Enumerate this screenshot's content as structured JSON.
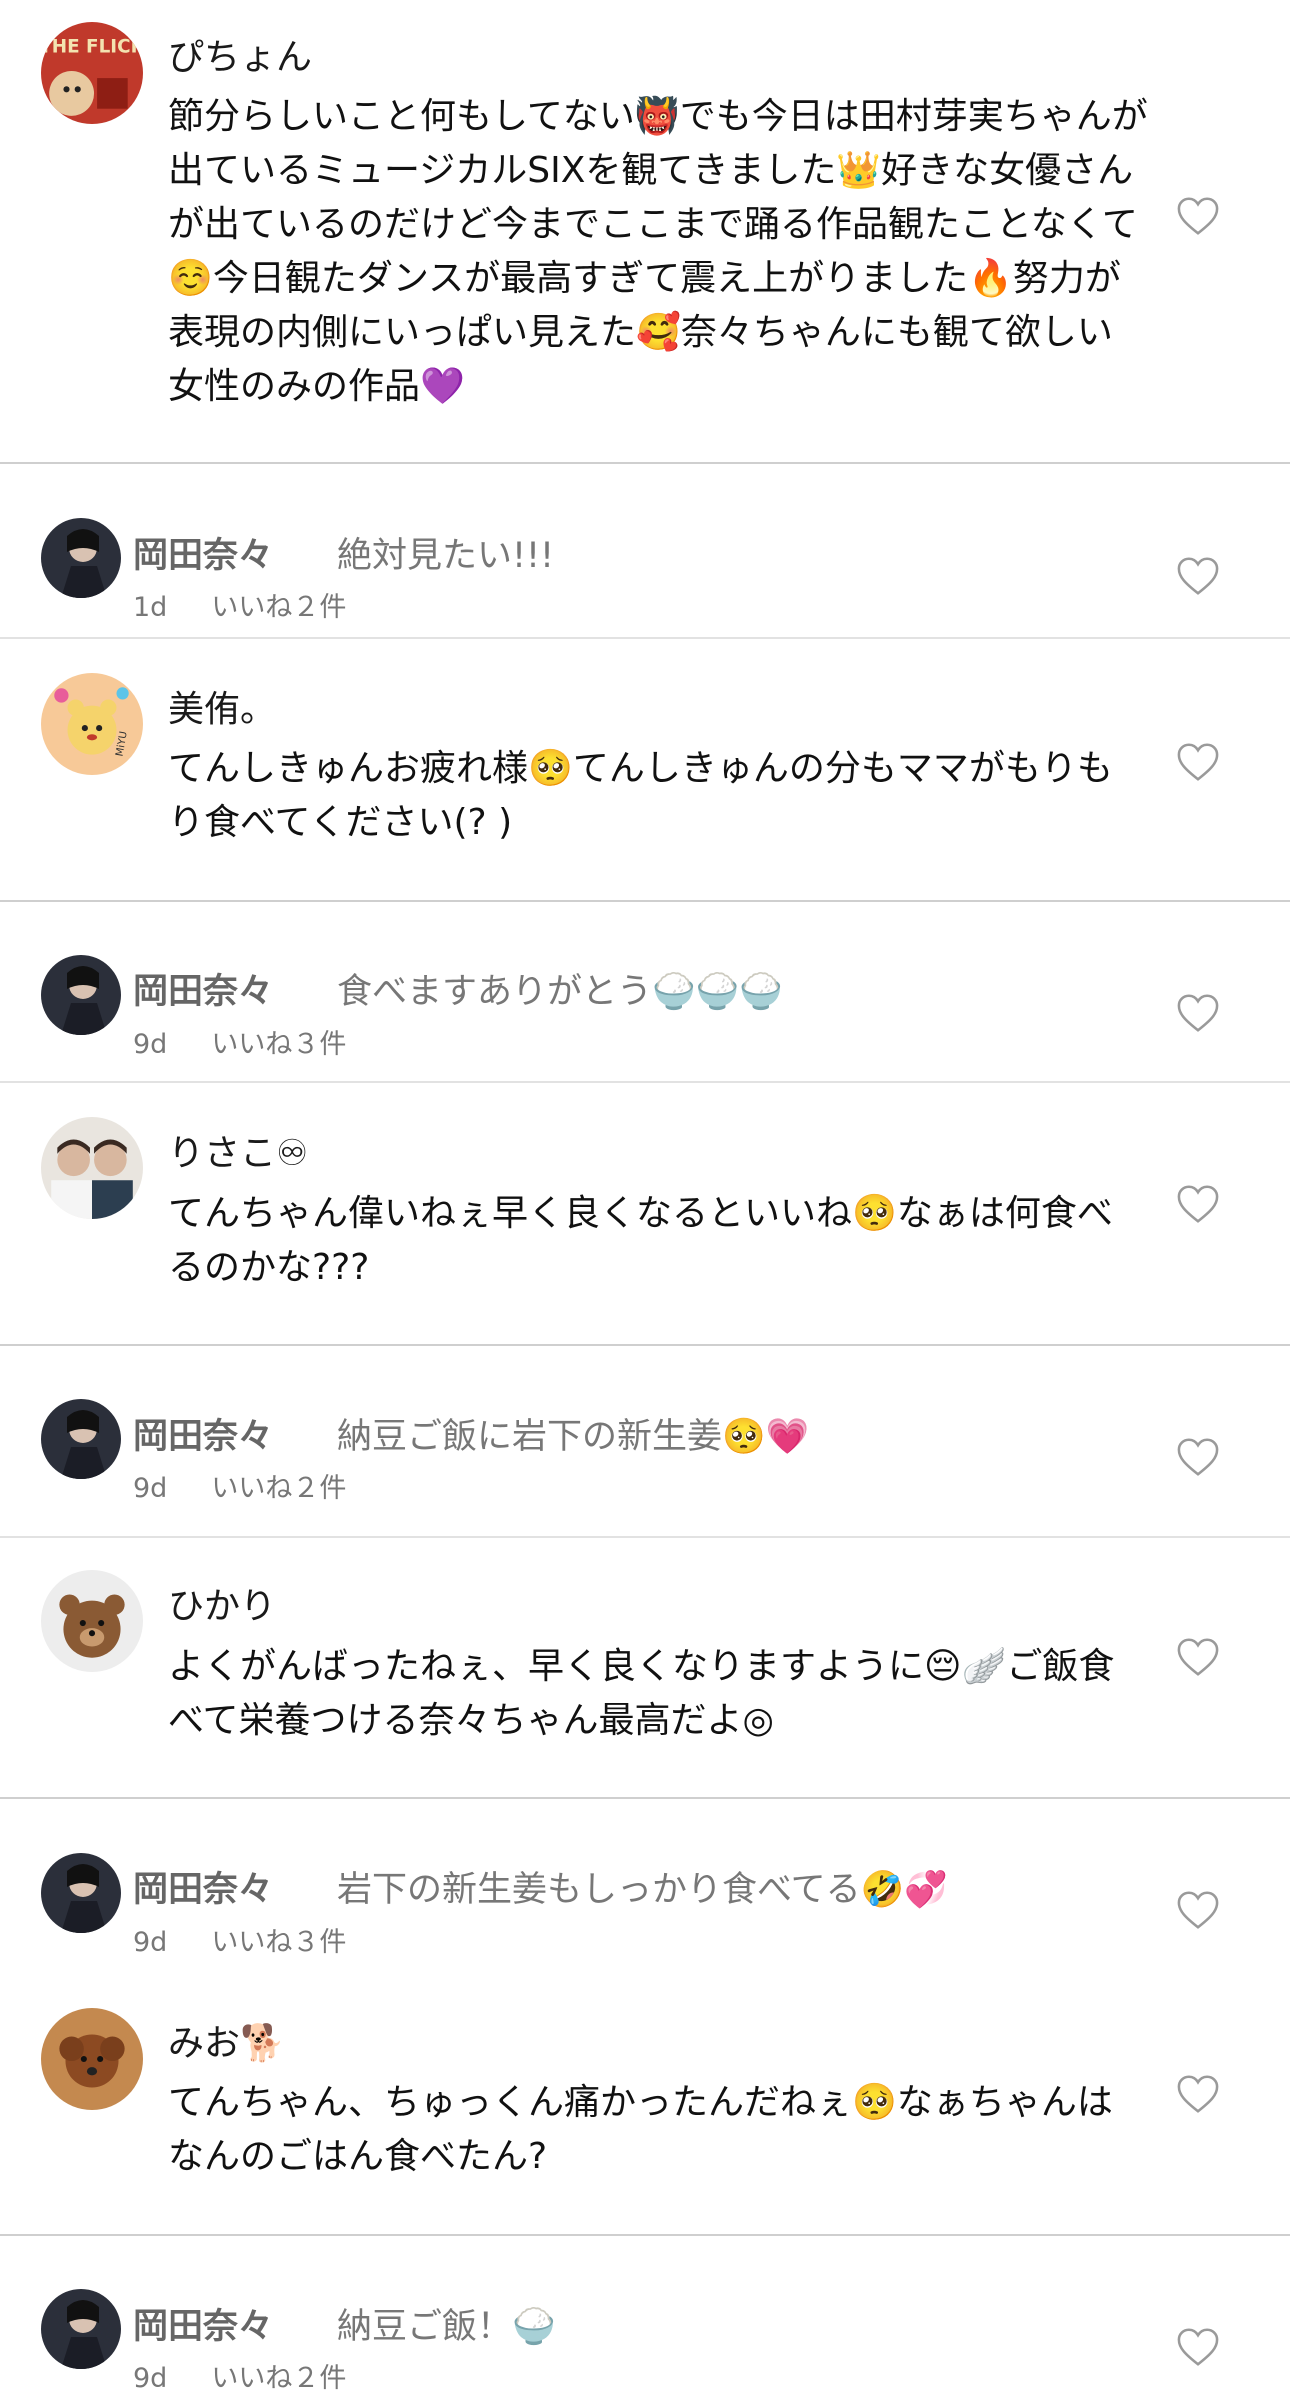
{
  "colors": {
    "text": "#111111",
    "reply_name": "#666666",
    "reply_text": "#777777",
    "meta": "#777777",
    "divider": "#cfcfcf",
    "heart_outline": "#9a9a9a"
  },
  "comments": [
    {
      "username": "ぴちょん",
      "text": "節分らしいこと何もしてない👹でも今日は田村芽実ちゃんが出ているミュージカルSIXを観てきました👑好きな女優さんが出ているのだけど今までここまで踊る作品観たことなくて☺️今日観たダンスが最高すぎて震え上がりました🔥努力が表現の内側にいっぱい見えた🥰奈々ちゃんにも観て欲しい女性のみの作品💜",
      "avatar_icon": "avatar-the-flick",
      "avatar_text": "THE FLICK",
      "reply": {
        "username": "岡田奈々",
        "text": "絶対見たい!!!",
        "time": "1d",
        "likes": "いいね２件"
      }
    },
    {
      "username": "美侑。",
      "text": "てんしきゅんお疲れ様🥺てんしきゅんの分もママがもりもり食べてください(?  )",
      "avatar_icon": "avatar-cartoon-bear",
      "avatar_text": "MiYU",
      "reply": {
        "username": "岡田奈々",
        "text": "食べますありがとう🍚🍚🍚",
        "time": "9d",
        "likes": "いいね３件"
      }
    },
    {
      "username": "りさこ♾",
      "text": "てんちゃん偉いねぇ早く良くなるといいね🥺なぁは何食べるのかな???",
      "avatar_icon": "avatar-photo",
      "reply": {
        "username": "岡田奈々",
        "text": "納豆ご飯に岩下の新生姜🥺💗",
        "time": "9d",
        "likes": "いいね２件"
      }
    },
    {
      "username": "ひかり",
      "text": "よくがんばったねぇ、早く良くなりますように😔🪽ご飯食べて栄養つける奈々ちゃん最高だよ◎",
      "avatar_icon": "avatar-teddy-bear",
      "reply": {
        "username": "岡田奈々",
        "text": "岩下の新生姜もしっかり食べてる🤣💞",
        "time": "9d",
        "likes": "いいね３件"
      }
    },
    {
      "username": "みお🐕",
      "text": "てんちゃん、ちゅっくん痛かったんだねぇ🥺なぁちゃんはなんのごはん食べたん?",
      "avatar_icon": "avatar-poodle",
      "reply": {
        "username": "岡田奈々",
        "text": "納豆ご飯！🍚",
        "time": "9d",
        "likes": "いいね２件"
      }
    }
  ]
}
